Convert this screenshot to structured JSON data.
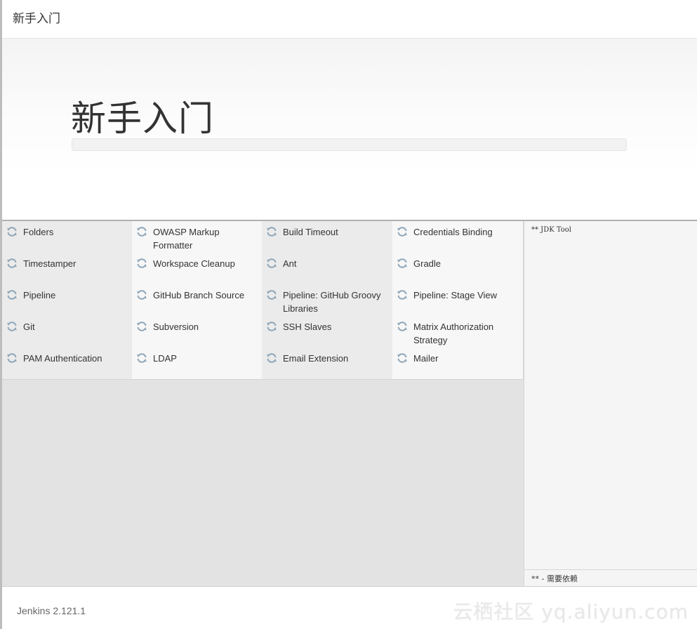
{
  "header": {
    "title": "新手入门"
  },
  "hero": {
    "title": "新手入门",
    "progress": 0
  },
  "plugins": [
    "Folders",
    "OWASP Markup Formatter",
    "Build Timeout",
    "Credentials Binding",
    "Timestamper",
    "Workspace Cleanup",
    "Ant",
    "Gradle",
    "Pipeline",
    "GitHub Branch Source",
    "Pipeline: GitHub Groovy Libraries",
    "Pipeline: Stage View",
    "Git",
    "Subversion",
    "SSH Slaves",
    "Matrix Authorization Strategy",
    "PAM Authentication",
    "LDAP",
    "Email Extension",
    "Mailer"
  ],
  "plugin_icon": "refresh-icon",
  "side_panel": {
    "log_text": "** JDK Tool",
    "footer_note": "** - 需要依赖"
  },
  "footer": {
    "version": "Jenkins 2.121.1",
    "watermark": "云栖社区 yq.aliyun.com"
  },
  "colors": {
    "accent": "#1f8bcf",
    "icon": "#8fa6b8",
    "cell_gray": "#ebebeb",
    "cell_light": "#f7f7f7"
  }
}
